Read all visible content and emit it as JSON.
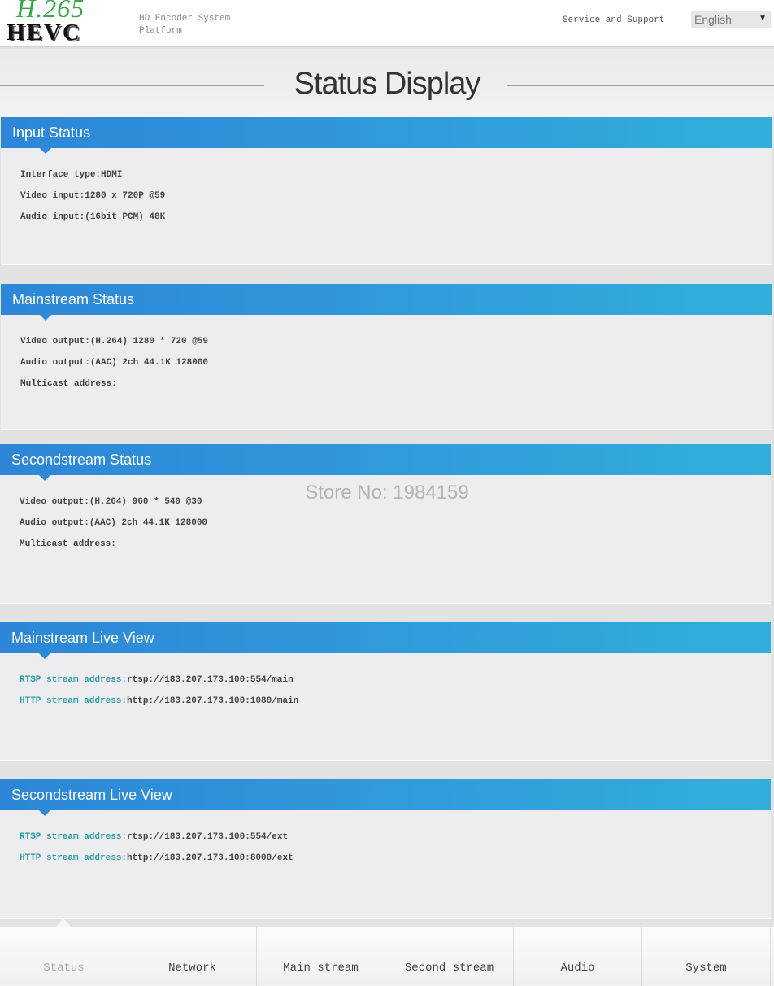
{
  "header": {
    "logo_top": "H.265",
    "logo_bottom": "HEVC",
    "platform_line1": "HD Encoder System",
    "platform_line2": "Platform",
    "service": "Service and Support",
    "language": "English"
  },
  "page_title": "Status Display",
  "watermark": "Store No: 1984159",
  "panels": [
    {
      "title": "Input Status",
      "rows": [
        {
          "k": "",
          "v": "Interface type:HDMI"
        },
        {
          "k": "",
          "v": "Video input:1280 x 720P @59"
        },
        {
          "k": "",
          "v": "Audio input:(16bit PCM) 48K"
        }
      ]
    },
    {
      "title": "Mainstream Status",
      "rows": [
        {
          "k": "",
          "v": "Video output:(H.264) 1280 * 720 @59"
        },
        {
          "k": "",
          "v": "Audio output:(AAC) 2ch 44.1K 128000"
        },
        {
          "k": "",
          "v": "Multicast address:"
        }
      ]
    },
    {
      "title": "Secondstream Status",
      "rows": [
        {
          "k": "",
          "v": "Video output:(H.264) 960 * 540 @30"
        },
        {
          "k": "",
          "v": "Audio output:(AAC) 2ch 44.1K 128000"
        },
        {
          "k": "",
          "v": "Multicast address:"
        }
      ]
    },
    {
      "title": "Mainstream Live View",
      "rows": [
        {
          "k": "RTSP stream address:",
          "v": "rtsp://183.207.173.100:554/main"
        },
        {
          "k": "HTTP stream address:",
          "v": "http://183.207.173.100:1080/main"
        }
      ]
    },
    {
      "title": "Secondstream Live View",
      "rows": [
        {
          "k": "RTSP stream address:",
          "v": "rtsp://183.207.173.100:554/ext"
        },
        {
          "k": "HTTP stream address:",
          "v": "http://183.207.173.100:8000/ext"
        }
      ]
    }
  ],
  "nav": [
    "Status",
    "Network",
    "Main stream",
    "Second stream",
    "Audio",
    "System"
  ],
  "colors": {
    "panel_header_start": "#2d86d8",
    "panel_header_end": "#32aedb",
    "link_key": "#2a9aa8"
  }
}
